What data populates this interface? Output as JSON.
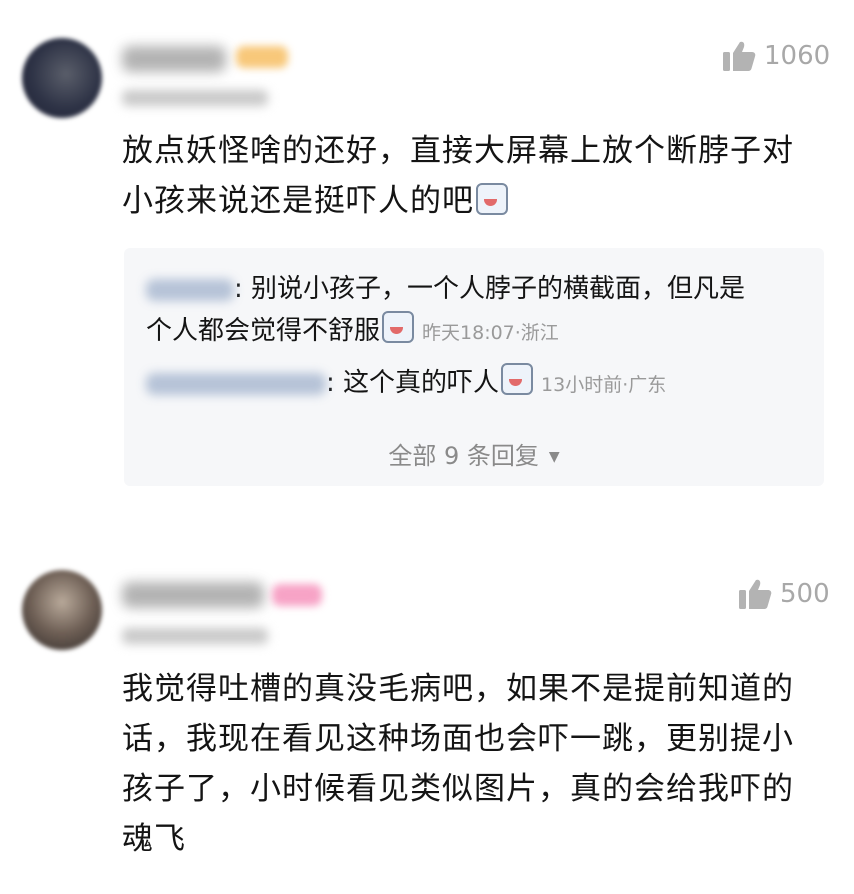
{
  "comments": [
    {
      "likes": "1060",
      "text_lines": [
        "放点妖怪啥的还好，直接大屏幕上放个断脖子对",
        "小孩来说还是挺吓人的吧"
      ],
      "emoji_icon": "sweat-smile-emoji",
      "badge_color": "#f8c87a",
      "replies": [
        {
          "text": "别说小孩子，一个人脖子的横截面，但凡是",
          "text2": "个人都会觉得不舒服",
          "meta": "昨天18:07·浙江"
        },
        {
          "text": "这个真的吓人",
          "meta": "13小时前·广东"
        }
      ],
      "more_label": "全部 9 条回复"
    },
    {
      "likes": "500",
      "text_lines": [
        "我觉得吐槽的真没毛病吧，如果不是提前知道的",
        "话，我现在看见这种场面也会吓一跳，更别提小",
        "孩子了，小时候看见类似图片，真的会给我吓的",
        "魂飞"
      ],
      "badge_color": "#f7a3c6"
    }
  ]
}
